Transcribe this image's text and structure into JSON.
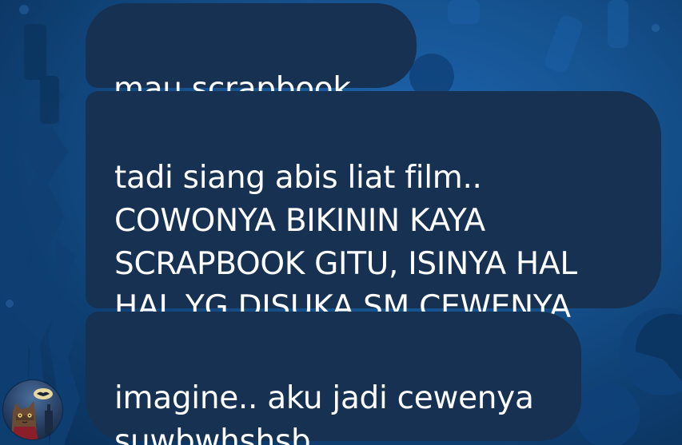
{
  "chat": {
    "messages": [
      {
        "text": "mau scrapbook..."
      },
      {
        "text": "tadi siang abis liat film..\nCOWONYA BIKININ KAYA\nSCRAPBOOK GITU, ISINYA HAL\nHAL YG DISUKA SM CEWENYA"
      },
      {
        "text": "imagine.. aku jadi cewenya\nsuwbwhshsb"
      }
    ]
  },
  "icons": {
    "avatar": "cat-avatar-icon"
  },
  "colors": {
    "bubble": "#173152",
    "text": "#ffffff",
    "background": "#15528f"
  }
}
